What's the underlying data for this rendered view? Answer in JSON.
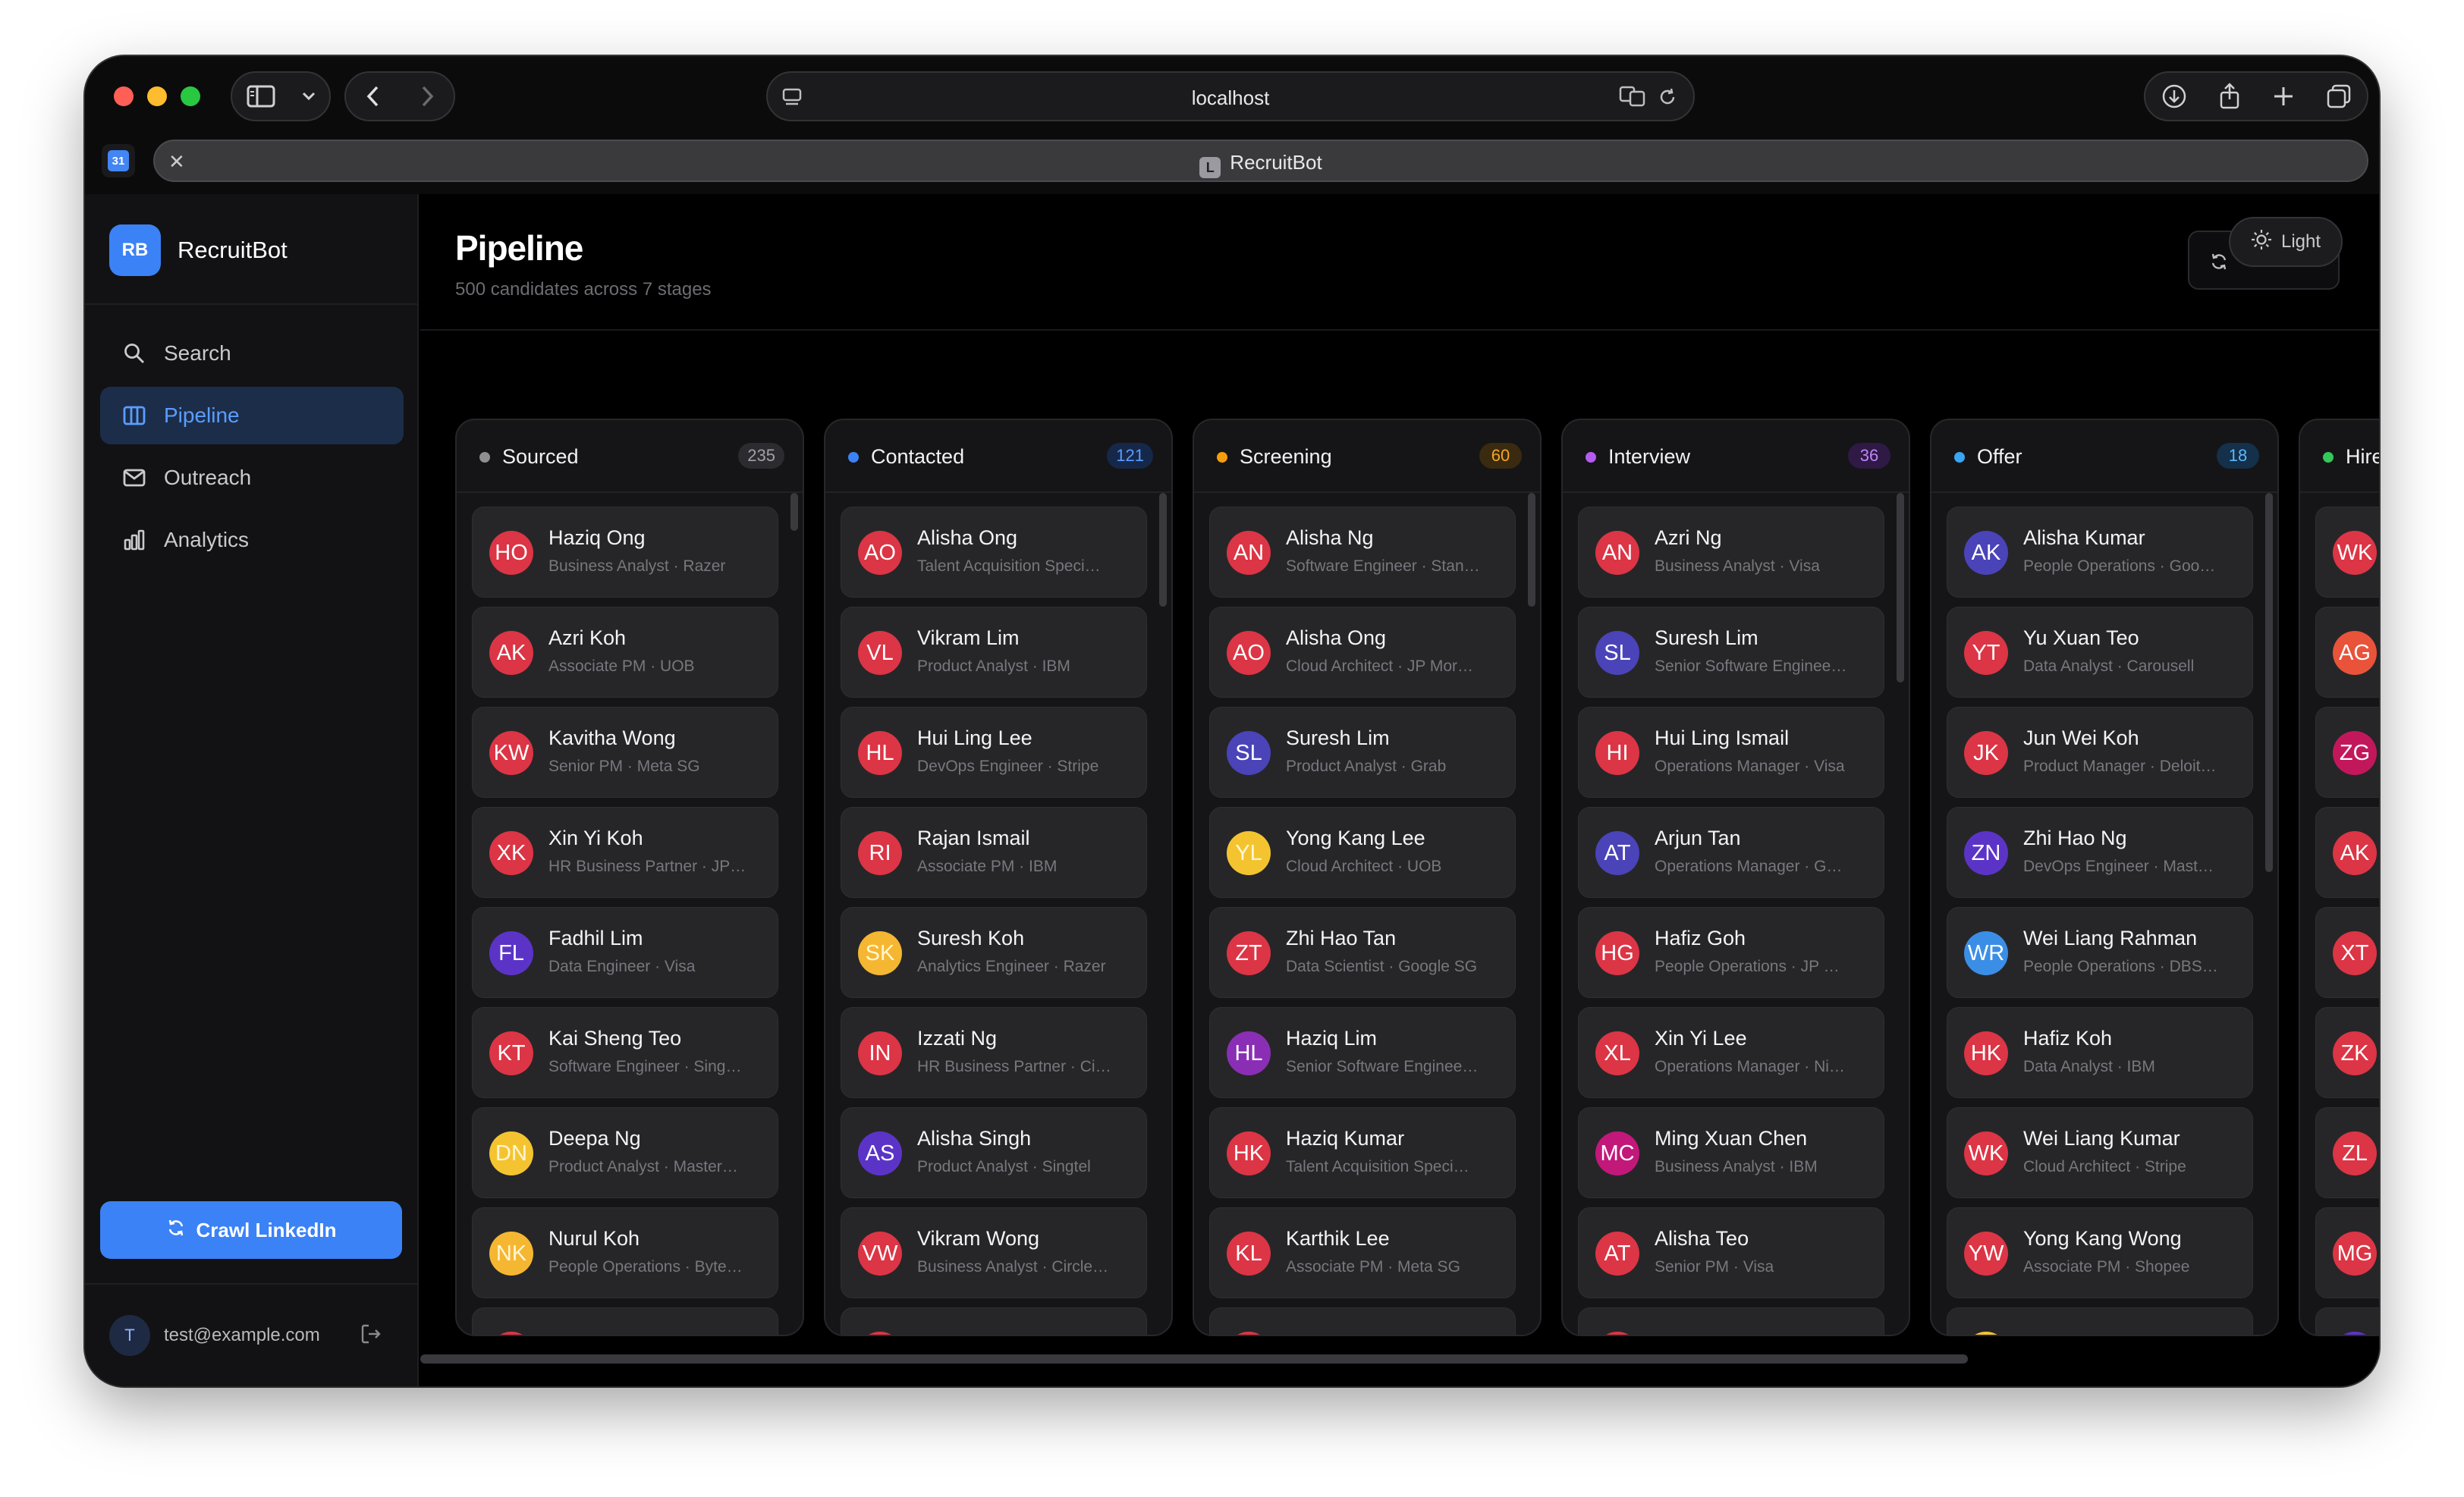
{
  "browser": {
    "url": "localhost",
    "tab_title": "RecruitBot",
    "tab_favicon_letter": "L",
    "pinned_favicon": "31"
  },
  "sidebar": {
    "logo_initials": "RB",
    "brand_name": "RecruitBot",
    "nav": [
      {
        "label": "Search",
        "icon": "search-icon"
      },
      {
        "label": "Pipeline",
        "icon": "columns-icon",
        "active": true
      },
      {
        "label": "Outreach",
        "icon": "mail-icon"
      },
      {
        "label": "Analytics",
        "icon": "bar-chart-icon"
      }
    ],
    "crawl_button": "Crawl LinkedIn",
    "user_initial": "T",
    "user_email": "test@example.com"
  },
  "header": {
    "title": "Pipeline",
    "subtitle": "500 candidates across 7 stages",
    "theme_toggle": "Light"
  },
  "stages": [
    {
      "name": "Sourced",
      "count": "235",
      "dot": "#8e8e93",
      "badge_bg": "#2c2c30",
      "badge_fg": "#a0a0a6",
      "candidates": [
        {
          "initials": "HO",
          "name": "Haziq Ong",
          "meta": "Business Analyst · Razer",
          "color": "#dc3545"
        },
        {
          "initials": "AK",
          "name": "Azri Koh",
          "meta": "Associate PM · UOB",
          "color": "#dc3545"
        },
        {
          "initials": "KW",
          "name": "Kavitha Wong",
          "meta": "Senior PM · Meta SG",
          "color": "#dc3545"
        },
        {
          "initials": "XK",
          "name": "Xin Yi Koh",
          "meta": "HR Business Partner · JP…",
          "color": "#dc3545"
        },
        {
          "initials": "FL",
          "name": "Fadhil Lim",
          "meta": "Data Engineer · Visa",
          "color": "#5b34c7"
        },
        {
          "initials": "KT",
          "name": "Kai Sheng Teo",
          "meta": "Software Engineer · Sing…",
          "color": "#dc3545"
        },
        {
          "initials": "DN",
          "name": "Deepa Ng",
          "meta": "Product Analyst · Master…",
          "color": "#f4c430"
        },
        {
          "initials": "NK",
          "name": "Nurul Koh",
          "meta": "People Operations · Byte…",
          "color": "#f5b731"
        },
        {
          "initials": "",
          "name": "",
          "meta": "",
          "color": "#dc3545"
        }
      ]
    },
    {
      "name": "Contacted",
      "count": "121",
      "dot": "#3b82f6",
      "badge_bg": "#16284a",
      "badge_fg": "#5b9dff",
      "candidates": [
        {
          "initials": "AO",
          "name": "Alisha Ong",
          "meta": "Talent Acquisition Speci…",
          "color": "#dc3545"
        },
        {
          "initials": "VL",
          "name": "Vikram Lim",
          "meta": "Product Analyst · IBM",
          "color": "#dc3545"
        },
        {
          "initials": "HL",
          "name": "Hui Ling Lee",
          "meta": "DevOps Engineer · Stripe",
          "color": "#dc3545"
        },
        {
          "initials": "RI",
          "name": "Rajan Ismail",
          "meta": "Associate PM · IBM",
          "color": "#dc3545"
        },
        {
          "initials": "SK",
          "name": "Suresh Koh",
          "meta": "Analytics Engineer · Razer",
          "color": "#f5b731"
        },
        {
          "initials": "IN",
          "name": "Izzati Ng",
          "meta": "HR Business Partner · Ci…",
          "color": "#dc3545"
        },
        {
          "initials": "AS",
          "name": "Alisha Singh",
          "meta": "Product Analyst · Singtel",
          "color": "#5b34c7"
        },
        {
          "initials": "VW",
          "name": "Vikram Wong",
          "meta": "Business Analyst · Circle…",
          "color": "#dc3545"
        },
        {
          "initials": "",
          "name": "",
          "meta": "",
          "color": "#dc3545"
        }
      ]
    },
    {
      "name": "Screening",
      "count": "60",
      "dot": "#f59e0b",
      "badge_bg": "#3a2a10",
      "badge_fg": "#f5a623",
      "candidates": [
        {
          "initials": "AN",
          "name": "Alisha Ng",
          "meta": "Software Engineer · Stan…",
          "color": "#dc3545"
        },
        {
          "initials": "AO",
          "name": "Alisha Ong",
          "meta": "Cloud Architect · JP Mor…",
          "color": "#dc3545"
        },
        {
          "initials": "SL",
          "name": "Suresh Lim",
          "meta": "Product Analyst · Grab",
          "color": "#4a44b8"
        },
        {
          "initials": "YL",
          "name": "Yong Kang Lee",
          "meta": "Cloud Architect · UOB",
          "color": "#f4c430"
        },
        {
          "initials": "ZT",
          "name": "Zhi Hao Tan",
          "meta": "Data Scientist · Google SG",
          "color": "#dc3545"
        },
        {
          "initials": "HL",
          "name": "Haziq Lim",
          "meta": "Senior Software Enginee…",
          "color": "#8a2fb5"
        },
        {
          "initials": "HK",
          "name": "Haziq Kumar",
          "meta": "Talent Acquisition Speci…",
          "color": "#dc3545"
        },
        {
          "initials": "KL",
          "name": "Karthik Lee",
          "meta": "Associate PM · Meta SG",
          "color": "#dc3545"
        },
        {
          "initials": "",
          "name": "",
          "meta": "",
          "color": "#dc3545"
        }
      ]
    },
    {
      "name": "Interview",
      "count": "36",
      "dot": "#b45cf0",
      "badge_bg": "#2e1a44",
      "badge_fg": "#c084fc",
      "candidates": [
        {
          "initials": "AN",
          "name": "Azri Ng",
          "meta": "Business Analyst · Visa",
          "color": "#dc3545"
        },
        {
          "initials": "SL",
          "name": "Suresh Lim",
          "meta": "Senior Software Enginee…",
          "color": "#4a44b8"
        },
        {
          "initials": "HI",
          "name": "Hui Ling Ismail",
          "meta": "Operations Manager · Visa",
          "color": "#dc3545"
        },
        {
          "initials": "AT",
          "name": "Arjun Tan",
          "meta": "Operations Manager · G…",
          "color": "#4a44b8"
        },
        {
          "initials": "HG",
          "name": "Hafiz Goh",
          "meta": "People Operations · JP …",
          "color": "#dc3545"
        },
        {
          "initials": "XL",
          "name": "Xin Yi Lee",
          "meta": "Operations Manager · Ni…",
          "color": "#dc3545"
        },
        {
          "initials": "MC",
          "name": "Ming Xuan Chen",
          "meta": "Business Analyst · IBM",
          "color": "#c2187a"
        },
        {
          "initials": "AT",
          "name": "Alisha Teo",
          "meta": "Senior PM · Visa",
          "color": "#dc3545"
        },
        {
          "initials": "",
          "name": "",
          "meta": "",
          "color": "#dc3545"
        }
      ]
    },
    {
      "name": "Offer",
      "count": "18",
      "dot": "#38a5f5",
      "badge_bg": "#14304a",
      "badge_fg": "#5bb8ff",
      "candidates": [
        {
          "initials": "AK",
          "name": "Alisha Kumar",
          "meta": "People Operations · Goo…",
          "color": "#4a44b8"
        },
        {
          "initials": "YT",
          "name": "Yu Xuan Teo",
          "meta": "Data Analyst · Carousell",
          "color": "#dc3545"
        },
        {
          "initials": "JK",
          "name": "Jun Wei Koh",
          "meta": "Product Manager · Deloit…",
          "color": "#dc3545"
        },
        {
          "initials": "ZN",
          "name": "Zhi Hao Ng",
          "meta": "DevOps Engineer · Mast…",
          "color": "#5b34c7"
        },
        {
          "initials": "WR",
          "name": "Wei Liang Rahman",
          "meta": "People Operations · DBS…",
          "color": "#3b8ee6"
        },
        {
          "initials": "HK",
          "name": "Hafiz Koh",
          "meta": "Data Analyst · IBM",
          "color": "#dc3545"
        },
        {
          "initials": "WK",
          "name": "Wei Liang Kumar",
          "meta": "Cloud Architect · Stripe",
          "color": "#dc3545"
        },
        {
          "initials": "YW",
          "name": "Yong Kang Wong",
          "meta": "Associate PM · Shopee",
          "color": "#dc3545"
        },
        {
          "initials": "",
          "name": "",
          "meta": "",
          "color": "#f4c430"
        }
      ]
    },
    {
      "name": "Hired",
      "count": "",
      "dot": "#34c759",
      "badge_bg": "#163a22",
      "badge_fg": "#34c759",
      "candidates": [
        {
          "initials": "WK",
          "name": "",
          "meta": "",
          "color": "#dc3545"
        },
        {
          "initials": "AG",
          "name": "",
          "meta": "",
          "color": "#e8533a"
        },
        {
          "initials": "ZG",
          "name": "",
          "meta": "",
          "color": "#c2185b"
        },
        {
          "initials": "AK",
          "name": "",
          "meta": "",
          "color": "#dc3545"
        },
        {
          "initials": "XT",
          "name": "",
          "meta": "",
          "color": "#dc3545"
        },
        {
          "initials": "ZK",
          "name": "",
          "meta": "",
          "color": "#dc3545"
        },
        {
          "initials": "ZL",
          "name": "",
          "meta": "",
          "color": "#dc3545"
        },
        {
          "initials": "MG",
          "name": "",
          "meta": "",
          "color": "#dc3545"
        },
        {
          "initials": "",
          "name": "",
          "meta": "",
          "color": "#5b34c7"
        }
      ]
    }
  ]
}
